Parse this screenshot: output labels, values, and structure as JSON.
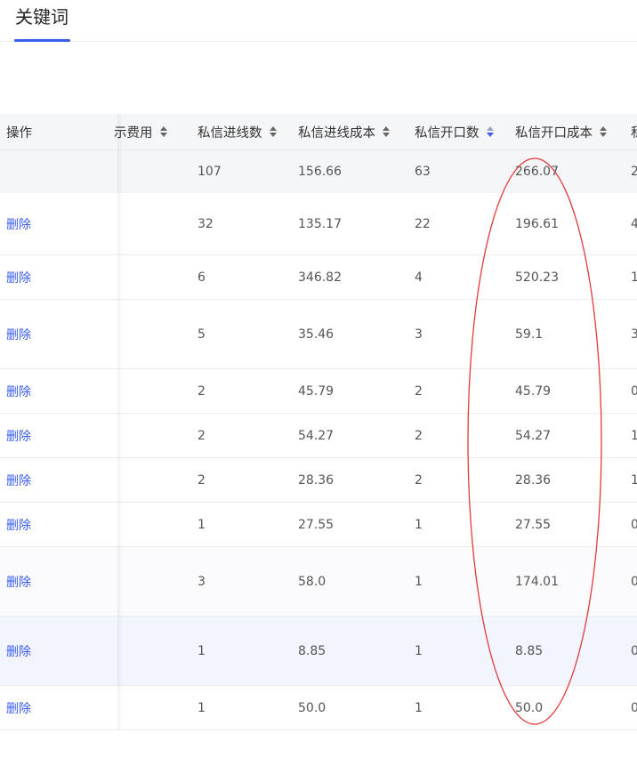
{
  "tabs": {
    "active_label": "关键词"
  },
  "table": {
    "headers": {
      "operation": "操作",
      "cost_partial": "示费用",
      "dm_leads_count": "私信进线数",
      "dm_leads_cost": "私信进线成本",
      "dm_open_count": "私信开口数",
      "dm_open_cost": "私信开口成本",
      "next_partial": "私"
    },
    "summary": {
      "dm_leads_count": "107",
      "dm_leads_cost": "156.66",
      "dm_open_count": "63",
      "dm_open_cost": "266.07",
      "next_partial": "2"
    },
    "delete_label": "删除",
    "rows": [
      {
        "dm_leads_count": "32",
        "dm_leads_cost": "135.17",
        "dm_open_count": "22",
        "dm_open_cost": "196.61",
        "next_partial": "4"
      },
      {
        "dm_leads_count": "6",
        "dm_leads_cost": "346.82",
        "dm_open_count": "4",
        "dm_open_cost": "520.23",
        "next_partial": "1"
      },
      {
        "dm_leads_count": "5",
        "dm_leads_cost": "35.46",
        "dm_open_count": "3",
        "dm_open_cost": "59.1",
        "next_partial": "3"
      },
      {
        "dm_leads_count": "2",
        "dm_leads_cost": "45.79",
        "dm_open_count": "2",
        "dm_open_cost": "45.79",
        "next_partial": "0"
      },
      {
        "dm_leads_count": "2",
        "dm_leads_cost": "54.27",
        "dm_open_count": "2",
        "dm_open_cost": "54.27",
        "next_partial": "1"
      },
      {
        "dm_leads_count": "2",
        "dm_leads_cost": "28.36",
        "dm_open_count": "2",
        "dm_open_cost": "28.36",
        "next_partial": "1"
      },
      {
        "dm_leads_count": "1",
        "dm_leads_cost": "27.55",
        "dm_open_count": "1",
        "dm_open_cost": "27.55",
        "next_partial": "0"
      },
      {
        "dm_leads_count": "3",
        "dm_leads_cost": "58.0",
        "dm_open_count": "1",
        "dm_open_cost": "174.01",
        "next_partial": "0"
      },
      {
        "dm_leads_count": "1",
        "dm_leads_cost": "8.85",
        "dm_open_count": "1",
        "dm_open_cost": "8.85",
        "next_partial": "0"
      },
      {
        "dm_leads_count": "1",
        "dm_leads_cost": "50.0",
        "dm_open_count": "1",
        "dm_open_cost": "50.0",
        "next_partial": "0"
      }
    ]
  },
  "colors": {
    "accent": "#3a5cf0",
    "annotation": "#e23a3a"
  }
}
